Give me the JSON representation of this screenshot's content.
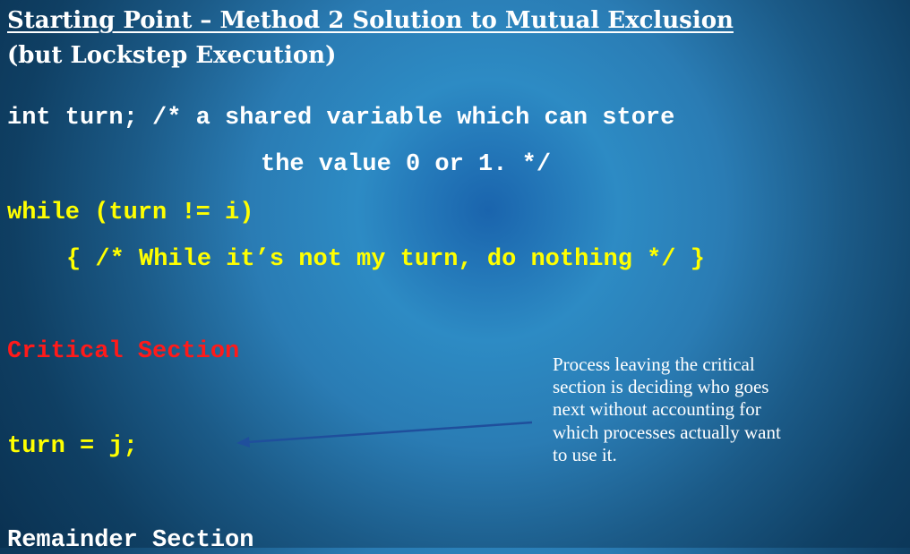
{
  "title": {
    "line1": "Starting Point – Method 2 Solution to Mutual Exclusion",
    "line2": "(but Lockstep Execution)"
  },
  "code": {
    "declaration_line1": "int turn; /* a shared variable which can store",
    "declaration_line2": "the value 0 or 1. */",
    "while_line": "while (turn != i)",
    "body_line": "{ /* While it’s not my turn, do nothing */ }",
    "critical_section": "Critical Section",
    "assignment": "turn = j;",
    "remainder_section": "Remainder Section"
  },
  "callout": {
    "lines": [
      "Process leaving the critical",
      "section is deciding who goes",
      "next without accounting for",
      "which processes actually want",
      "to use it."
    ]
  },
  "colors": {
    "title": "#ffffff",
    "declaration": "#ffffff",
    "code_highlight": "#ffff00",
    "critical_section": "#ff1a1a",
    "arrow": "#1f4f9c"
  }
}
